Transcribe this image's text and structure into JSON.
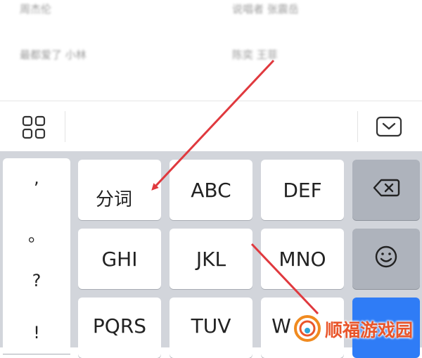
{
  "list": {
    "row1": {
      "left": "周杰伦",
      "right": "说唱者 张震岳"
    },
    "row2": {
      "left": "最都爱了 小林",
      "right": "陈奕 王菲"
    }
  },
  "toolbar": {
    "grid_icon": "grid-icon",
    "hide_keyboard_icon": "keyboard-hide-icon"
  },
  "keyboard": {
    "punctuation": [
      ",",
      "。",
      "?",
      "!"
    ],
    "keys": {
      "fenci": "分词",
      "abc": "ABC",
      "def": "DEF",
      "ghi": "GHI",
      "jkl": "JKL",
      "mno": "MNO",
      "pqrs": "PQRS",
      "tuv": "TUV",
      "wxyz": "W"
    },
    "delete_icon": "backspace-icon",
    "emoji_icon": "smiley-icon"
  },
  "annotation": {
    "color": "#e0393e"
  },
  "watermark": {
    "text": "顺福游戏园",
    "color": "#e9552a"
  }
}
